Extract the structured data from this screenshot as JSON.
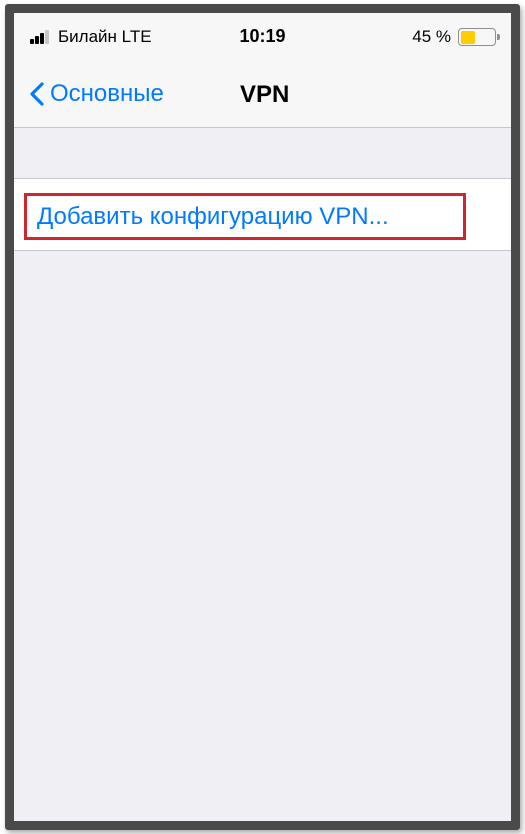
{
  "status_bar": {
    "carrier": "Билайн  LTE",
    "time": "10:19",
    "battery_percent": "45 %",
    "battery_level": 0.45,
    "battery_color": "#ffcc00",
    "signal_bars_filled": 3,
    "signal_bars_total": 4
  },
  "nav_bar": {
    "back_label": "Основные",
    "back_icon": "chevron-left-icon",
    "title": "VPN"
  },
  "content": {
    "add_vpn_label": "Добавить конфигурацию VPN...",
    "highlight_color": "#d2262f"
  },
  "colors": {
    "accent": "#007aff",
    "background": "#efeff4"
  }
}
